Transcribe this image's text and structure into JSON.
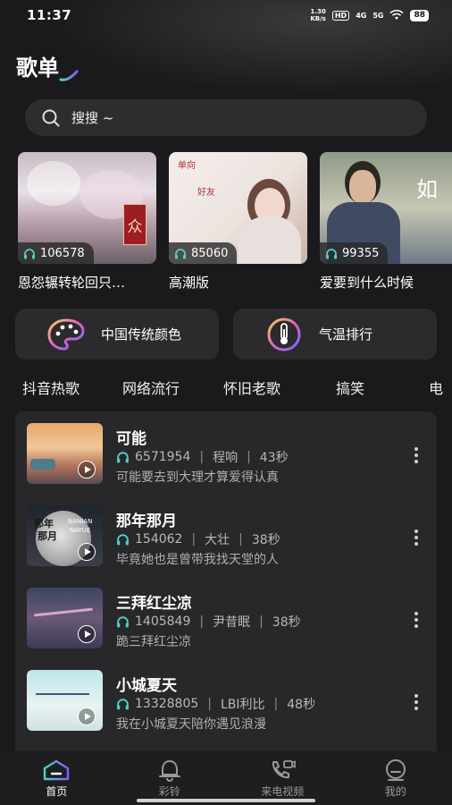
{
  "status_bar": {
    "time": "11:37",
    "net_speed_value": "1.30",
    "net_speed_unit": "KB/s",
    "hd_label": "HD",
    "sig1_label": "4G",
    "sig2_label": "5G",
    "battery": "88"
  },
  "page_title": "歌单",
  "search": {
    "placeholder": "搜搜 ~"
  },
  "playlists": [
    {
      "title": "恩怨辗转轮回只…",
      "play_count": "106578"
    },
    {
      "title": "高潮版",
      "play_count": "85060"
    },
    {
      "title": "爱要到什么时候",
      "play_count": "99355"
    }
  ],
  "cover_texts": {
    "pl1_stamp": "众",
    "pl2_top": "单向",
    "pl2_mid": "好友",
    "pl3_side": "如"
  },
  "categories": [
    {
      "label": "中国传统颜色"
    },
    {
      "label": "气温排行"
    }
  ],
  "tags": [
    "抖音热歌",
    "网络流行",
    "怀旧老歌",
    "搞笑",
    "电"
  ],
  "songs": [
    {
      "name": "可能",
      "plays": "6571954",
      "artist": "程响",
      "duration": "43秒",
      "desc": "可能要去到大理才算爱得认真"
    },
    {
      "name": "那年那月",
      "plays": "154062",
      "artist": "大壮",
      "duration": "38秒",
      "desc": "毕竟她也是曾带我找天堂的人"
    },
    {
      "name": "三拜红尘凉",
      "plays": "1405849",
      "artist": "尹昔眠",
      "duration": "38秒",
      "desc": "跪三拜红尘凉"
    },
    {
      "name": "小城夏天",
      "plays": "13328805",
      "artist": "LBI利比",
      "duration": "48秒",
      "desc": "我在小城夏天陪你遇见浪漫"
    }
  ],
  "song_cover_texts": {
    "s2_line1": "那年",
    "s2_line2": "那月",
    "s2_en1": "NANIAN",
    "s2_en2": "NAYUE"
  },
  "bottom_nav": [
    {
      "label": "首页",
      "icon": "home-icon",
      "active": true
    },
    {
      "label": "彩铃",
      "icon": "bell-icon",
      "active": false
    },
    {
      "label": "来电视频",
      "icon": "phone-video-icon",
      "active": false
    },
    {
      "label": "我的",
      "icon": "profile-icon",
      "active": false
    }
  ],
  "colors": {
    "background": "#1a1a1c",
    "card": "#28282b",
    "accent_teal": "#4fd1c5",
    "accent_purple": "#8a5cf6"
  }
}
